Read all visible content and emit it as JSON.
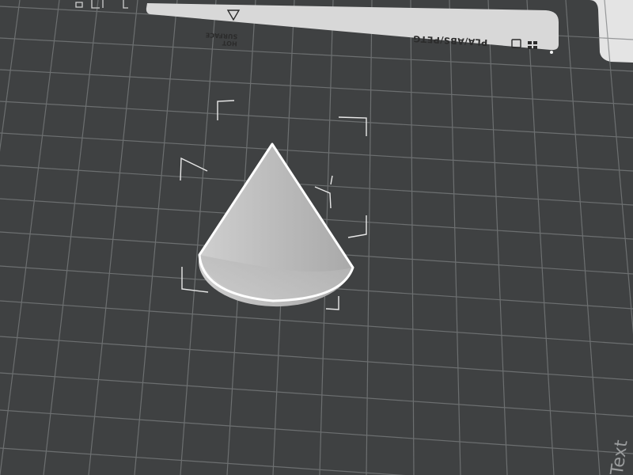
{
  "bed": {
    "label_material": "PLA/ABS/PETG",
    "label_hot_line1": "HOT",
    "label_hot_line2": "SURFACE",
    "corner_text": "Text"
  },
  "scene": {
    "object": "cone",
    "object_color": "#b9b9b9",
    "outline_color": "#ffffff",
    "bed_color": "#3f4142",
    "grid_color": "#7c7f80",
    "background_color": "#e4e4e4"
  }
}
